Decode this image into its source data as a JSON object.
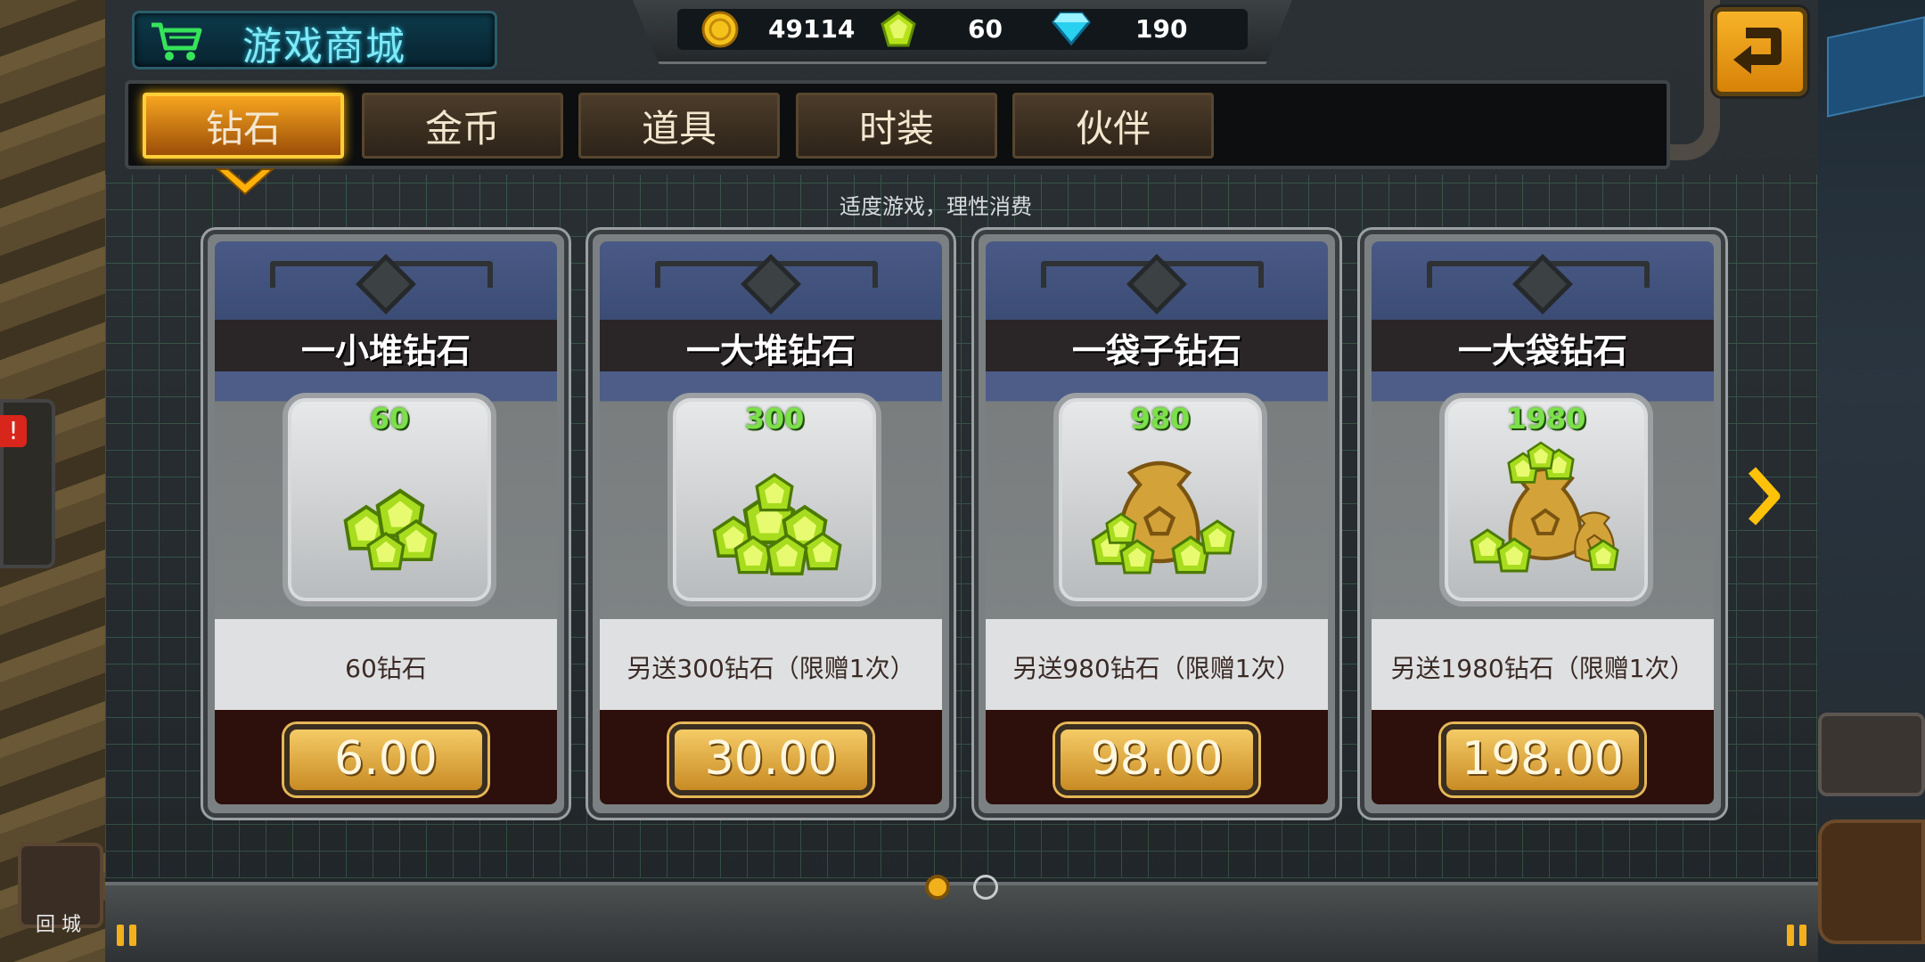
{
  "header": {
    "title": "游戏商城"
  },
  "currency": {
    "gold": "49114",
    "green_gems": "60",
    "blue_gems": "190"
  },
  "tabs": [
    {
      "label": "钻石",
      "active": true
    },
    {
      "label": "金币",
      "active": false
    },
    {
      "label": "道具",
      "active": false
    },
    {
      "label": "时装",
      "active": false
    },
    {
      "label": "伙伴",
      "active": false
    }
  ],
  "notice": "适度游戏，理性消费",
  "products": [
    {
      "title": "一小堆钻石",
      "qty": "60",
      "desc": "60钻石",
      "price": "6.00",
      "art": "small-gem-pile-icon"
    },
    {
      "title": "一大堆钻石",
      "qty": "300",
      "desc": "另送300钻石（限赠1次）",
      "price": "30.00",
      "art": "large-gem-pile-icon"
    },
    {
      "title": "一袋子钻石",
      "qty": "980",
      "desc": "另送980钻石（限赠1次）",
      "price": "98.00",
      "art": "gem-bag-icon"
    },
    {
      "title": "一大袋钻石",
      "qty": "1980",
      "desc": "另送1980钻石（限赠1次）",
      "price": "198.00",
      "art": "big-gem-bags-icon"
    }
  ],
  "pagination": {
    "current": 1,
    "total": 2
  },
  "side": {
    "town_label": "回 城",
    "alert_badge": "!"
  },
  "colors": {
    "tab_active": "#f6a51f",
    "gem_green": "#9ee024",
    "qty_green": "#7be04a",
    "title_cyan": "#7fe9f6"
  }
}
